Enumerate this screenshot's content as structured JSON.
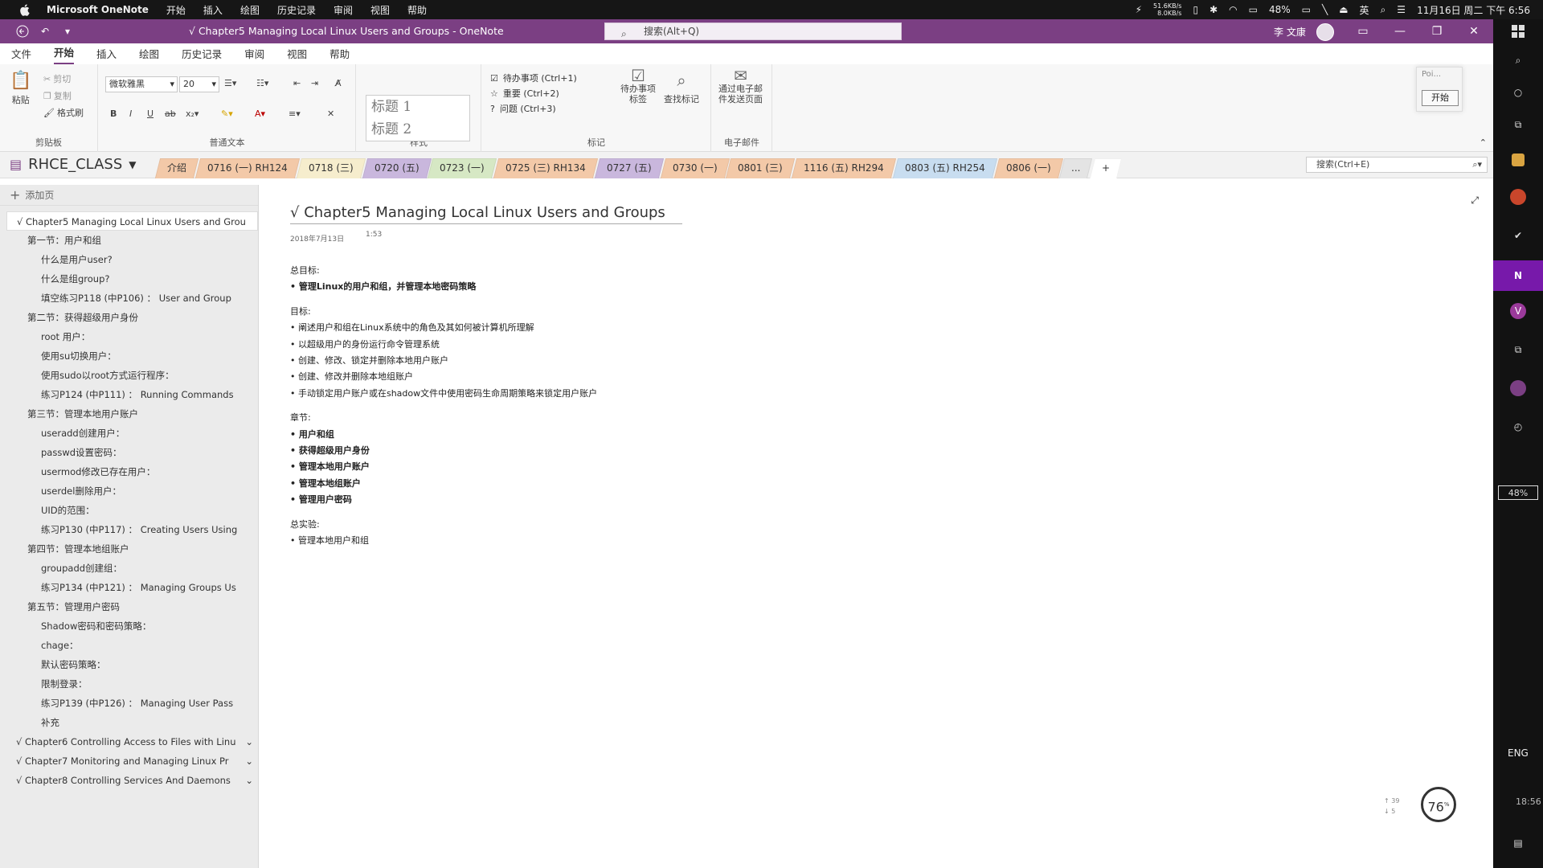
{
  "macbar": {
    "app_name": "Microsoft OneNote",
    "menus": [
      "开始",
      "插入",
      "绘图",
      "历史记录",
      "审阅",
      "视图",
      "帮助"
    ],
    "net_up": "51.6KB/s",
    "net_down": "8.0KB/s",
    "battery": "48%",
    "datetime": "11月16日 周二 下午 6:56"
  },
  "titlebar": {
    "title": "√ Chapter5 Managing Local Linux Users and Groups  -  OneNote",
    "search_placeholder": "搜索(Alt+Q)",
    "user_name": "李 文康"
  },
  "menutabs": [
    "文件",
    "开始",
    "插入",
    "绘图",
    "历史记录",
    "审阅",
    "视图",
    "帮助"
  ],
  "ribbon": {
    "clipboard": {
      "paste": "粘贴",
      "cut": "剪切",
      "copy": "复制",
      "format_painter": "格式刷",
      "label": "剪贴板"
    },
    "basic_text": {
      "font": "微软雅黑",
      "size": "20",
      "label": "普通文本"
    },
    "styles": {
      "h1": "标题 1",
      "h2": "标题 2",
      "label": "样式"
    },
    "tags": {
      "items": [
        "待办事项 (Ctrl+1)",
        "重要 (Ctrl+2)",
        "问题 (Ctrl+3)"
      ],
      "todo_tag": "待办事项\n标签",
      "find_tags": "查找标记",
      "label": "标记"
    },
    "email": {
      "send": "通过电子邮\n件发送页面",
      "label": "电子邮件"
    }
  },
  "pomodoro": {
    "title": "Poi...",
    "start": "开始"
  },
  "notebook": {
    "name": "RHCE_CLASS",
    "sections": [
      "介绍",
      "0716 (一) RH124",
      "0718 (三)",
      "0720 (五)",
      "0723 (一)",
      "0725 (三) RH134",
      "0727 (五)",
      "0730 (一)",
      "0801 (三)",
      "1116 (五) RH294",
      "0803 (五) RH254",
      "0806 (一)",
      "..."
    ],
    "section_colors": [
      "#f3c9a8",
      "#f3c9a8",
      "#f2e4a7",
      "#c9b7dd",
      "#d6e8c4",
      "#f3c9a8",
      "#c9b7dd",
      "#f3c9a8",
      "#f3c9a8",
      "#f3c9a8",
      "#c8ddf0",
      "#f3c9a8",
      "#e4e4e4"
    ],
    "search_placeholder": "搜索(Ctrl+E)"
  },
  "pagelist": {
    "add_page": "添加页",
    "pages": [
      {
        "title": "√ Chapter5 Managing Local Linux Users and Grou",
        "level": 0,
        "selected": true
      },
      {
        "title": "第一节：用户和组",
        "level": 1
      },
      {
        "title": "什么是用户user?",
        "level": 2
      },
      {
        "title": "什么是组group?",
        "level": 2
      },
      {
        "title": "填空练习P118 (中P106) ： User and Group",
        "level": 2
      },
      {
        "title": "第二节：获得超级用户身份",
        "level": 1
      },
      {
        "title": "root 用户：",
        "level": 2
      },
      {
        "title": "使用su切换用户：",
        "level": 2
      },
      {
        "title": "使用sudo以root方式运行程序：",
        "level": 2
      },
      {
        "title": "练习P124 (中P111) ： Running Commands",
        "level": 2
      },
      {
        "title": "第三节：管理本地用户账户",
        "level": 1
      },
      {
        "title": "useradd创建用户：",
        "level": 2
      },
      {
        "title": "passwd设置密码：",
        "level": 2
      },
      {
        "title": "usermod修改已存在用户：",
        "level": 2
      },
      {
        "title": "userdel删除用户：",
        "level": 2
      },
      {
        "title": "UID的范围：",
        "level": 2
      },
      {
        "title": "练习P130 (中P117) ： Creating Users Using",
        "level": 2
      },
      {
        "title": "第四节：管理本地组账户",
        "level": 1
      },
      {
        "title": "groupadd创建组：",
        "level": 2
      },
      {
        "title": "练习P134 (中P121) ： Managing Groups Us",
        "level": 2
      },
      {
        "title": "第五节：管理用户密码",
        "level": 1
      },
      {
        "title": "Shadow密码和密码策略：",
        "level": 2
      },
      {
        "title": "chage：",
        "level": 2
      },
      {
        "title": "默认密码策略：",
        "level": 2
      },
      {
        "title": "限制登录：",
        "level": 2
      },
      {
        "title": "练习P139 (中P126) ： Managing User Pass",
        "level": 2
      },
      {
        "title": "补充",
        "level": 2
      },
      {
        "title": "√ Chapter6 Controlling Access to Files with Linu",
        "level": 0,
        "collapsible": true
      },
      {
        "title": "√ Chapter7 Monitoring and Managing Linux Pr",
        "level": 0,
        "collapsible": true
      },
      {
        "title": "√ Chapter8 Controlling Services And Daemons",
        "level": 0,
        "collapsible": true
      }
    ]
  },
  "page": {
    "title": "√ Chapter5 Managing Local Linux Users and Groups",
    "date": "2018年7月13日",
    "time": "1:53",
    "blocks": [
      {
        "text": "总目标:",
        "bold": false
      },
      {
        "text": "• 管理Linux的用户和组，并管理本地密码策略",
        "bold": true
      },
      {
        "text": "",
        "bold": false
      },
      {
        "text": "目标:",
        "bold": false
      },
      {
        "text": "• 阐述用户和组在Linux系统中的角色及其如何被计算机所理解",
        "bold": false
      },
      {
        "text": "• 以超级用户的身份运行命令管理系统",
        "bold": false
      },
      {
        "text": "• 创建、修改、锁定并删除本地用户账户",
        "bold": false
      },
      {
        "text": "• 创建、修改并删除本地组账户",
        "bold": false
      },
      {
        "text": "• 手动锁定用户账户或在shadow文件中使用密码生命周期策略来锁定用户账户",
        "bold": false
      },
      {
        "text": "",
        "bold": false
      },
      {
        "text": "章节:",
        "bold": false
      },
      {
        "text": "• 用户和组",
        "bold": true
      },
      {
        "text": "• 获得超级用户身份",
        "bold": true
      },
      {
        "text": "• 管理本地用户账户",
        "bold": true
      },
      {
        "text": "• 管理本地组账户",
        "bold": true
      },
      {
        "text": "• 管理用户密码",
        "bold": true
      },
      {
        "text": "",
        "bold": false
      },
      {
        "text": "总实验:",
        "bold": false
      },
      {
        "text": "• 管理本地用户和组",
        "bold": false
      }
    ]
  },
  "dock": {
    "battery": "48%",
    "lang": "ENG",
    "time": "18:56"
  },
  "widget": {
    "percent": "76",
    "percent_sign": "%",
    "up": "↑ 39",
    "down": "↓ 5"
  },
  "colors": {
    "accent": "#7b3f83",
    "onenote_purple": "#7719aa"
  }
}
